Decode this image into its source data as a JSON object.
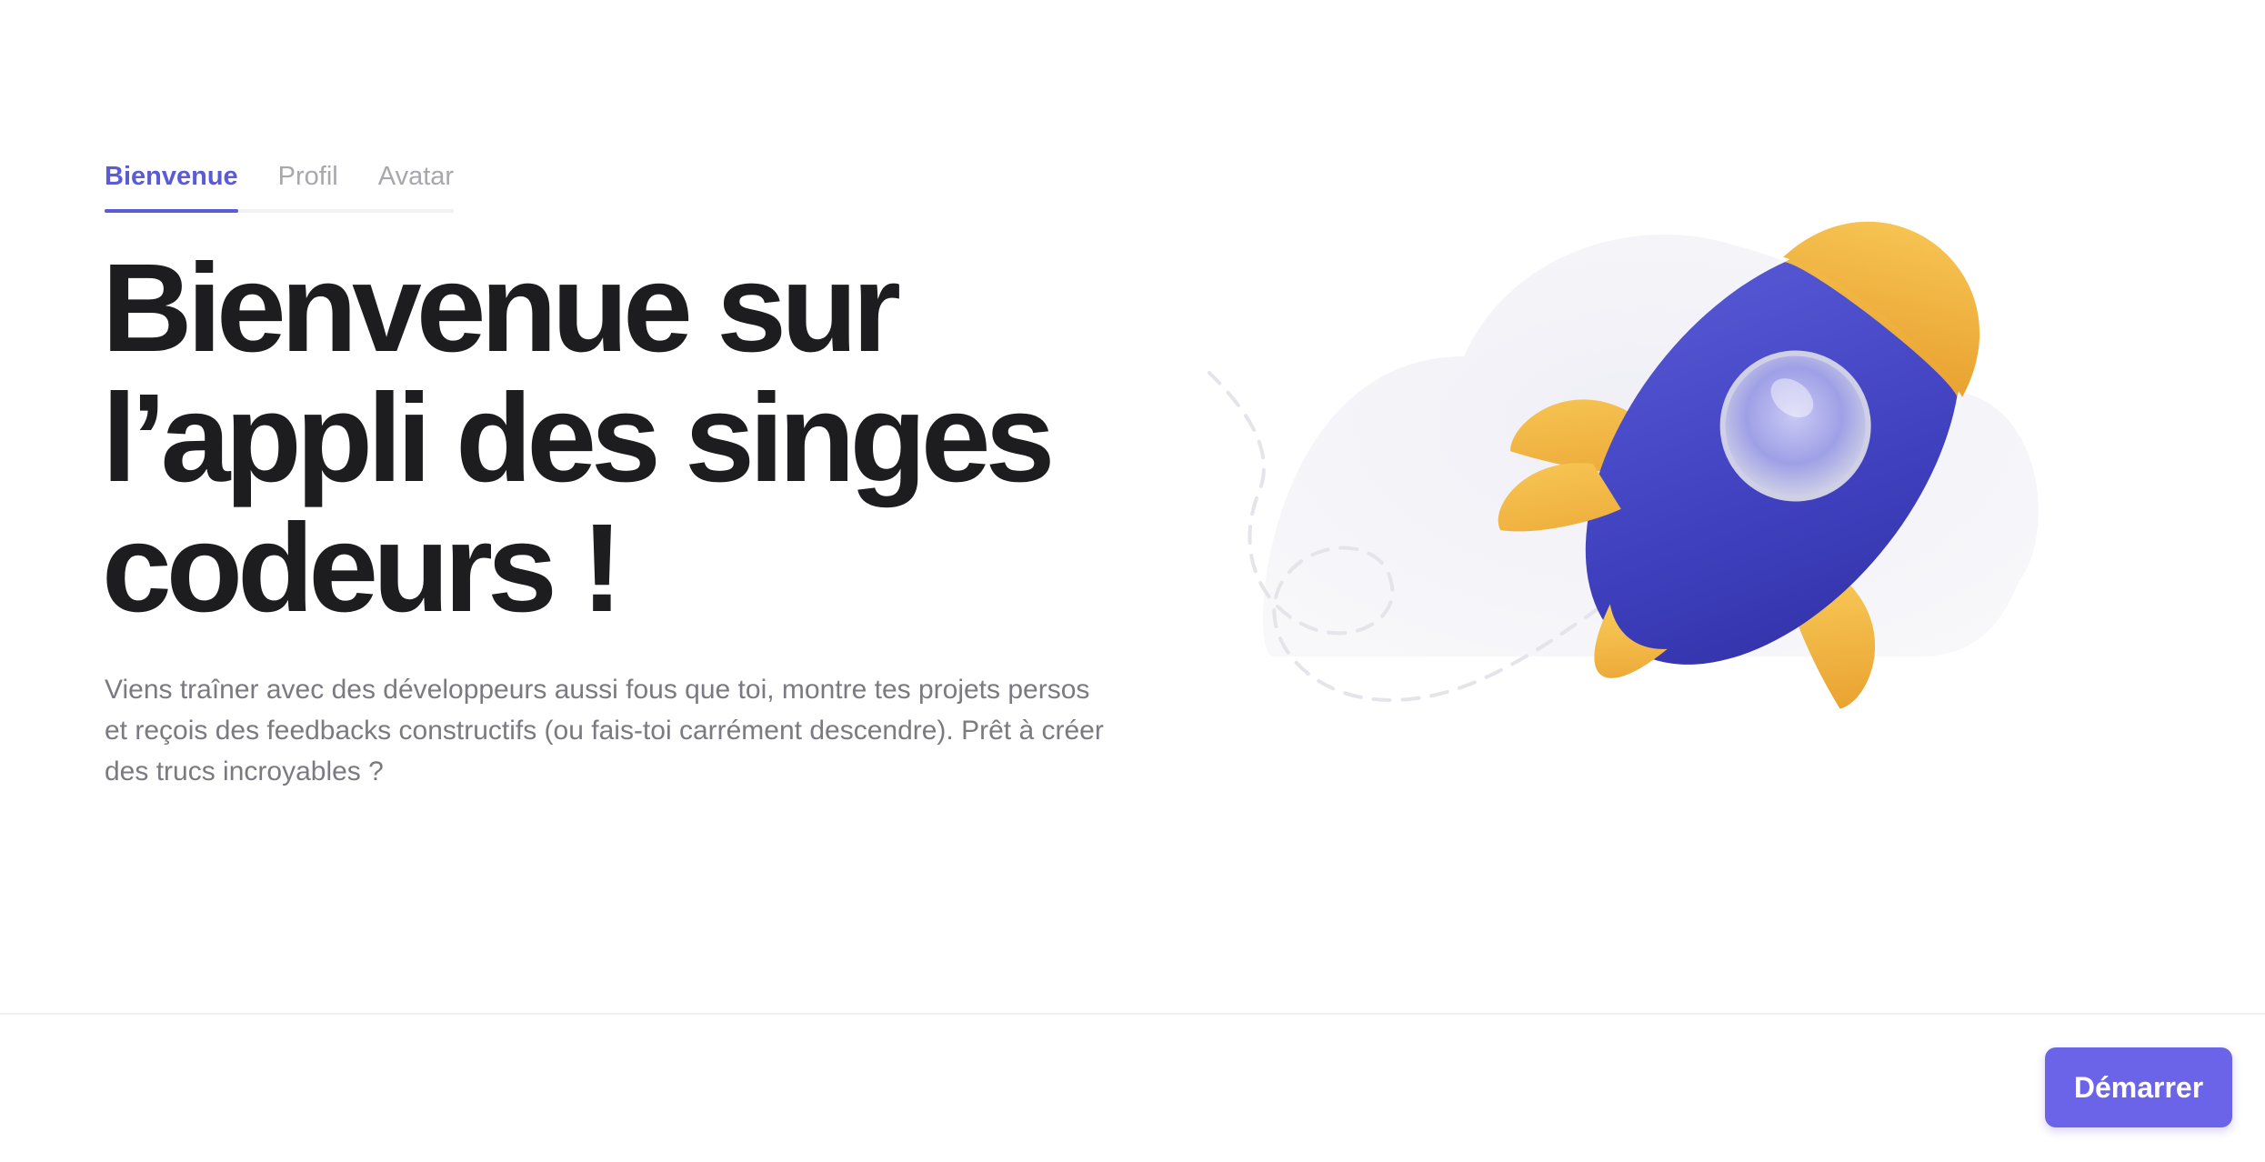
{
  "tabs": [
    {
      "label": "Bienvenue",
      "active": true
    },
    {
      "label": "Profil",
      "active": false
    },
    {
      "label": "Avatar",
      "active": false
    }
  ],
  "hero": {
    "title_line1": "Bienvenue sur",
    "title_line2": "l’appli des singes",
    "title_line3": "codeurs !",
    "description": "Viens traîner avec des développeurs aussi fous que toi, montre tes projets persos et reçois des feedbacks constructifs (ou fais-toi carrément descendre). Prêt à créer des trucs incroyables ?"
  },
  "illustration": {
    "icon": "rocket-icon",
    "colors": {
      "rocket_body": "#4547c4",
      "rocket_fins": "#f3b63f",
      "cloud": "#ececf3"
    }
  },
  "footer": {
    "start_label": "Démarrer"
  },
  "colors": {
    "accent": "#5b5bd6",
    "button": "#6b63e8",
    "heading": "#1d1d1f",
    "muted_text": "#7a7a80",
    "inactive_tab": "#a7a7ad"
  }
}
